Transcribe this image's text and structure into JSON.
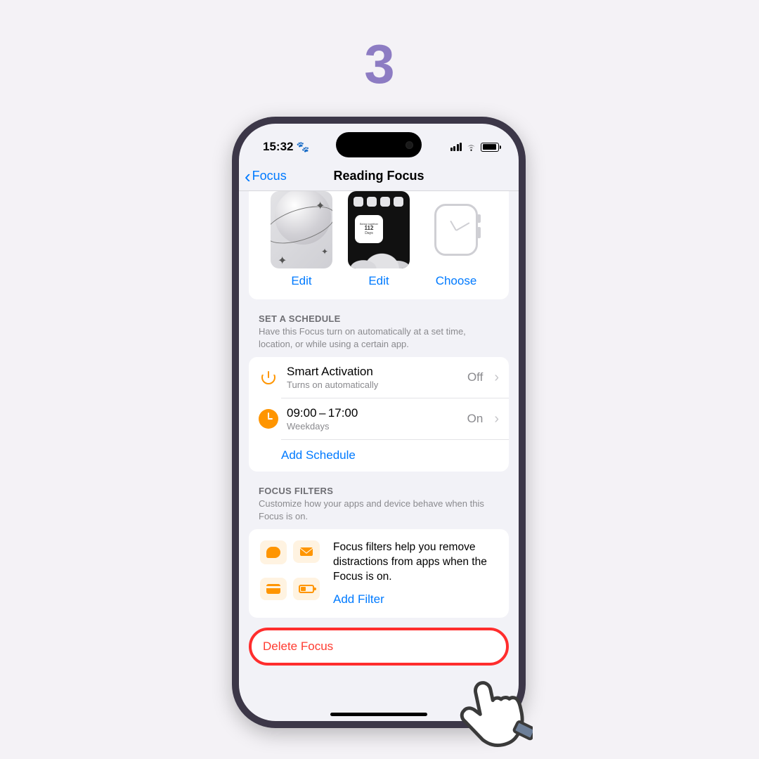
{
  "step_number": "3",
  "status": {
    "time": "15:32"
  },
  "nav": {
    "back": "Focus",
    "title": "Reading Focus"
  },
  "previews": {
    "lock_label": "Edit",
    "home_label": "Edit",
    "home_widget_top": "Being together",
    "home_widget_num": "112",
    "home_widget_bot": "Days",
    "watch_label": "Choose"
  },
  "schedule": {
    "heading": "SET A SCHEDULE",
    "description": "Have this Focus turn on automatically at a set time, location, or while using a certain app.",
    "smart_title": "Smart Activation",
    "smart_sub": "Turns on automatically",
    "smart_value": "Off",
    "time_title": "09:00 – 17:00",
    "time_sub": "Weekdays",
    "time_value": "On",
    "add": "Add Schedule"
  },
  "filters": {
    "heading": "FOCUS FILTERS",
    "description": "Customize how your apps and device behave when this Focus is on.",
    "body": "Focus filters help you remove distractions from apps when the Focus is on.",
    "add": "Add Filter"
  },
  "delete": {
    "label": "Delete Focus"
  }
}
